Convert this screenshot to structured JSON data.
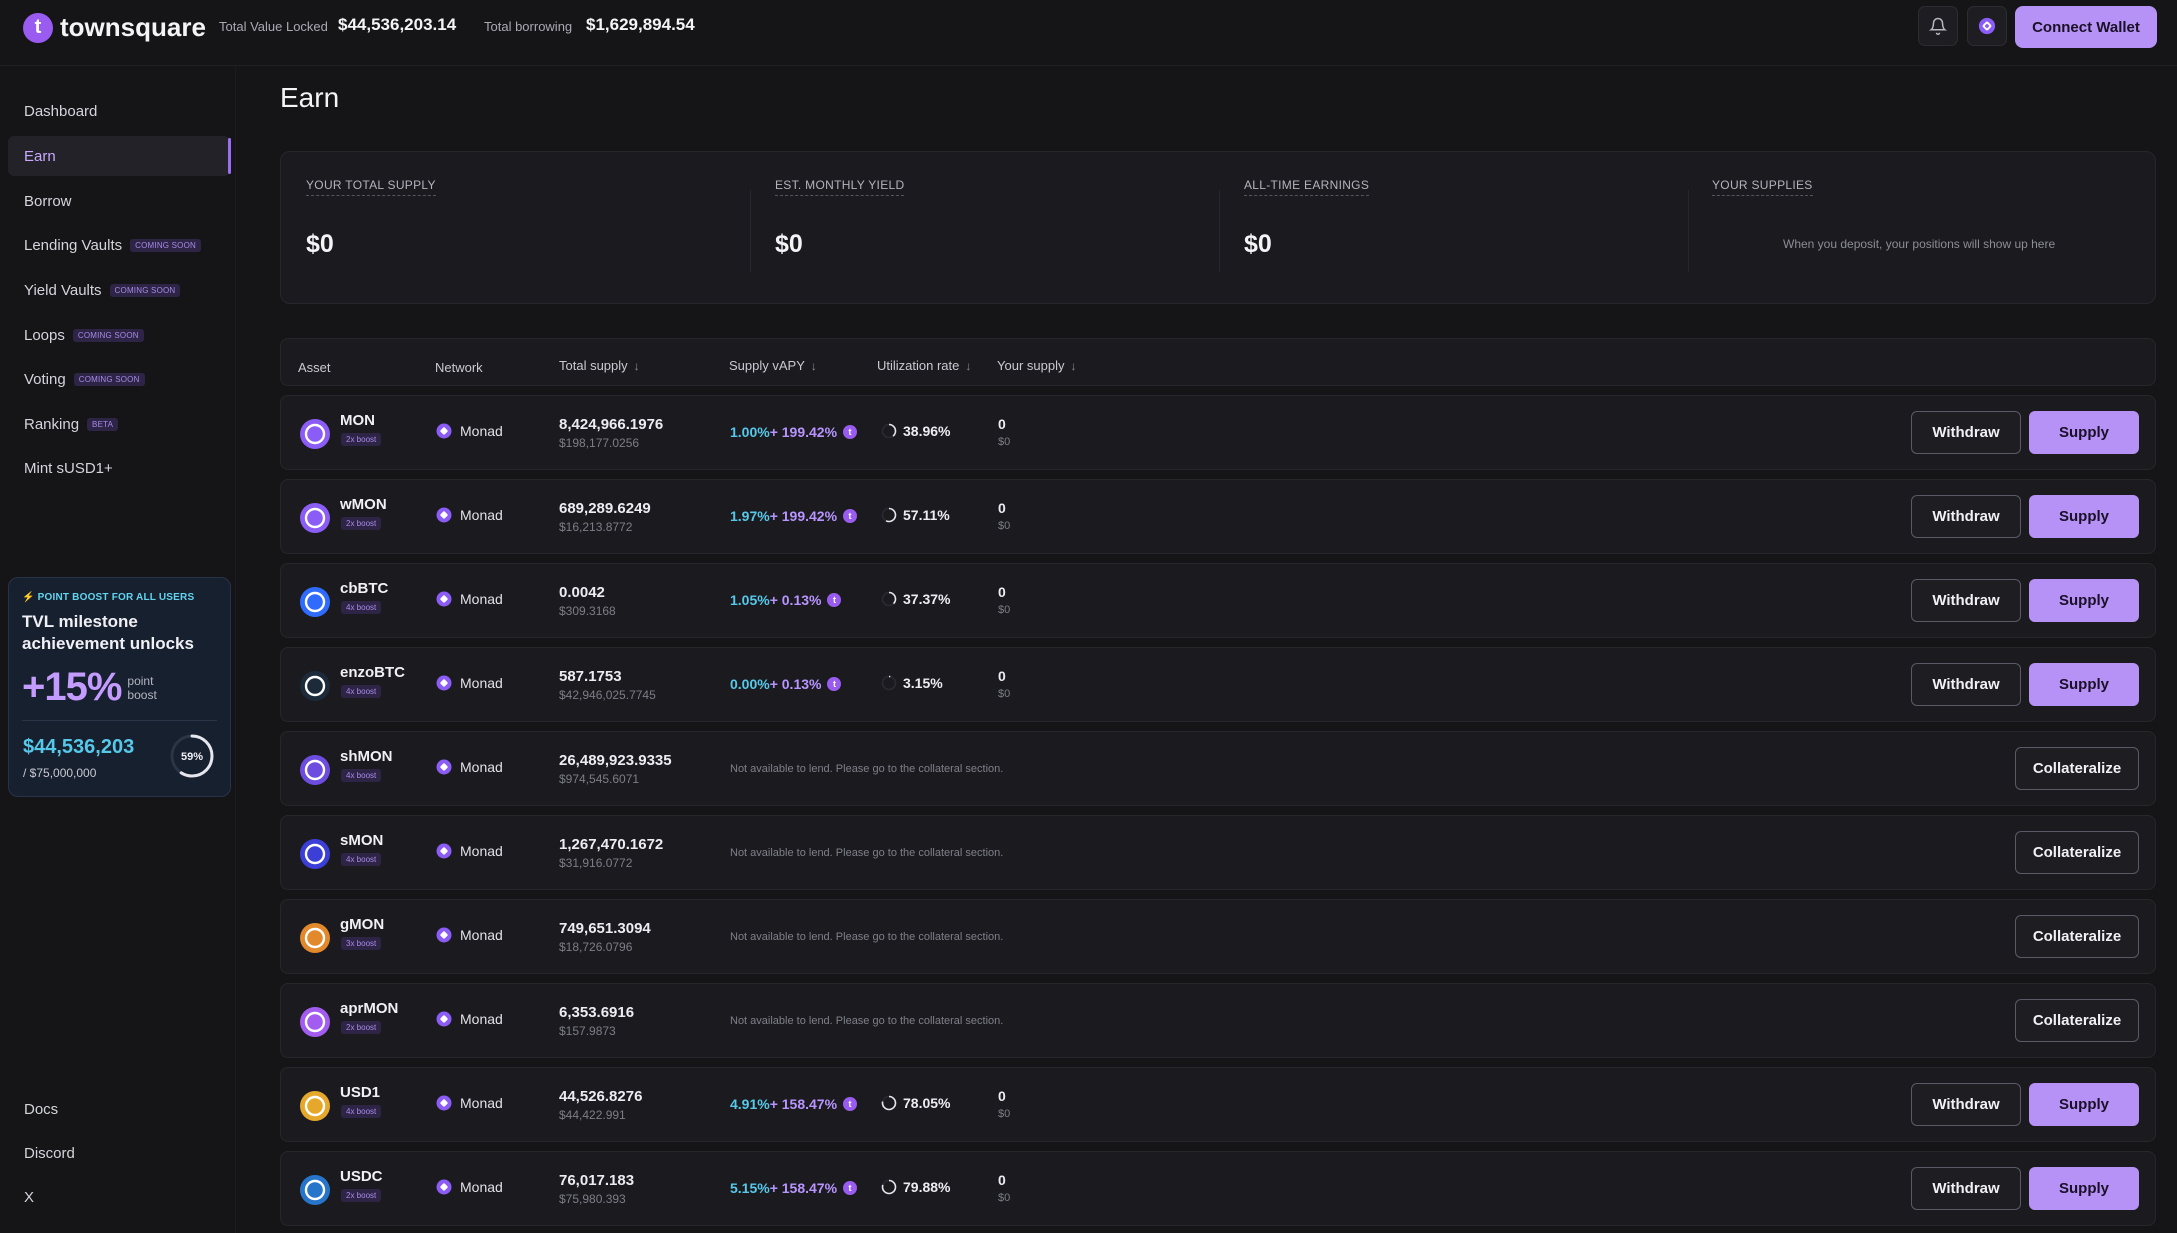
{
  "brand": {
    "name": "townsquare",
    "mark": "t"
  },
  "header": {
    "tvl_label": "Total Value Locked",
    "tvl_value": "$44,536,203.14",
    "borrow_label": "Total borrowing",
    "borrow_value": "$1,629,894.54",
    "bell_icon": "bell-icon",
    "network_icon": "monad-icon",
    "connect_label": "Connect Wallet"
  },
  "sidebar": {
    "items": [
      {
        "label": "Dashboard",
        "badge": ""
      },
      {
        "label": "Earn",
        "badge": ""
      },
      {
        "label": "Borrow",
        "badge": ""
      },
      {
        "label": "Lending Vaults",
        "badge": "COMING SOON"
      },
      {
        "label": "Yield Vaults",
        "badge": "COMING SOON"
      },
      {
        "label": "Loops",
        "badge": "COMING SOON"
      },
      {
        "label": "Voting",
        "badge": "COMING SOON"
      },
      {
        "label": "Ranking",
        "badge": "BETA"
      },
      {
        "label": "Mint sUSD1+",
        "badge": ""
      }
    ],
    "boost": {
      "tag": "POINT BOOST FOR ALL USERS",
      "title": "TVL milestone achievement unlocks",
      "pct": "+15%",
      "word1": "point",
      "word2": "boost",
      "tvl": "$44,536,203",
      "goal": "/ $75,000,000",
      "progress_label": "59%",
      "progress": 0.59
    },
    "links": [
      "Docs",
      "Discord",
      "X"
    ]
  },
  "page": {
    "title": "Earn"
  },
  "summary": {
    "total_supply_label": "YOUR TOTAL SUPPLY",
    "total_supply_value": "$0",
    "monthly_yield_label": "EST. MONTHLY YIELD",
    "monthly_yield_value": "$0",
    "earnings_label": "ALL-TIME EARNINGS",
    "earnings_value": "$0",
    "supplies_label": "YOUR SUPPLIES",
    "supplies_empty": "When you deposit, your positions will show up here"
  },
  "table": {
    "headers": {
      "asset": "Asset",
      "network": "Network",
      "total_supply": "Total supply",
      "apy": "Supply vAPY",
      "util": "Utilization rate",
      "your": "Your supply"
    },
    "withdraw_label": "Withdraw",
    "supply_label": "Supply",
    "collateralize_label": "Collateralize",
    "rows": [
      {
        "asset": "MON",
        "boost": "2x boost",
        "icon_color": "#8b5cf6",
        "network": "Monad",
        "supply": "8,424,966.1976",
        "supply_usd": "$198,177.0256",
        "lendable": true,
        "apy_base": "1.00%",
        "apy_bonus": "+ 199.42%",
        "util": "38.96%",
        "util_value": 0.3896,
        "your": "0",
        "your_usd": "$0"
      },
      {
        "asset": "wMON",
        "boost": "2x boost",
        "icon_color": "#8b5cf6",
        "network": "Monad",
        "supply": "689,289.6249",
        "supply_usd": "$16,213.8772",
        "lendable": true,
        "apy_base": "1.97%",
        "apy_bonus": "+ 199.42%",
        "util": "57.11%",
        "util_value": 0.5711,
        "your": "0",
        "your_usd": "$0"
      },
      {
        "asset": "cbBTC",
        "boost": "4x boost",
        "icon_color": "#2f6bff",
        "network": "Monad",
        "supply": "0.0042",
        "supply_usd": "$309.3168",
        "lendable": true,
        "apy_base": "1.05%",
        "apy_bonus": "+ 0.13%",
        "util": "37.37%",
        "util_value": 0.3737,
        "your": "0",
        "your_usd": "$0"
      },
      {
        "asset": "enzoBTC",
        "boost": "4x boost",
        "icon_color": "#1c2a3a",
        "network": "Monad",
        "supply": "587.1753",
        "supply_usd": "$42,946,025.7745",
        "lendable": true,
        "apy_base": "0.00%",
        "apy_bonus": "+ 0.13%",
        "util": "3.15%",
        "util_value": 0.0315,
        "your": "0",
        "your_usd": "$0"
      },
      {
        "asset": "shMON",
        "boost": "4x boost",
        "icon_color": "#6d4ce0",
        "network": "Monad",
        "supply": "26,489,923.9335",
        "supply_usd": "$974,545.6071",
        "lendable": false,
        "notice": "Not available to lend. Please go to the collateral section."
      },
      {
        "asset": "sMON",
        "boost": "4x boost",
        "icon_color": "#3b3fd8",
        "network": "Monad",
        "supply": "1,267,470.1672",
        "supply_usd": "$31,916.0772",
        "lendable": false,
        "notice": "Not available to lend. Please go to the collateral section."
      },
      {
        "asset": "gMON",
        "boost": "3x boost",
        "icon_color": "#e2892b",
        "network": "Monad",
        "supply": "749,651.3094",
        "supply_usd": "$18,726.0796",
        "lendable": false,
        "notice": "Not available to lend. Please go to the collateral section."
      },
      {
        "asset": "aprMON",
        "boost": "2x boost",
        "icon_color": "#a35cf0",
        "network": "Monad",
        "supply": "6,353.6916",
        "supply_usd": "$157.9873",
        "lendable": false,
        "notice": "Not available to lend. Please go to the collateral section."
      },
      {
        "asset": "USD1",
        "boost": "4x boost",
        "icon_color": "#e5a82a",
        "network": "Monad",
        "supply": "44,526.8276",
        "supply_usd": "$44,422.991",
        "lendable": true,
        "apy_base": "4.91%",
        "apy_bonus": "+ 158.47%",
        "util": "78.05%",
        "util_value": 0.7805,
        "your": "0",
        "your_usd": "$0"
      },
      {
        "asset": "USDC",
        "boost": "2x boost",
        "icon_color": "#2775ca",
        "network": "Monad",
        "supply": "76,017.183",
        "supply_usd": "$75,980.393",
        "lendable": true,
        "apy_base": "5.15%",
        "apy_bonus": "+ 158.47%",
        "util": "79.88%",
        "util_value": 0.7988,
        "your": "0",
        "your_usd": "$0"
      }
    ]
  }
}
